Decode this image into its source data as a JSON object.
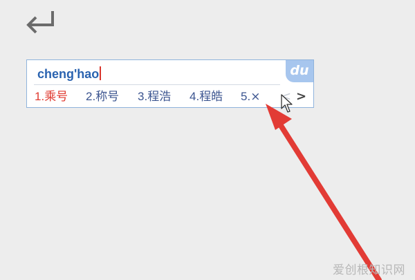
{
  "ime_window": {
    "composition": "cheng'hao",
    "logo_text": "du",
    "candidates": [
      {
        "index": "1.",
        "text": "乘号"
      },
      {
        "index": "2.",
        "text": "称号"
      },
      {
        "index": "3.",
        "text": "程浩"
      },
      {
        "index": "4.",
        "text": "程皓"
      },
      {
        "index": "5.",
        "text": "×"
      }
    ],
    "prev_page": "<",
    "next_page": ">"
  },
  "annotation_color": "#e23b35",
  "watermark": "爱创根知识网"
}
